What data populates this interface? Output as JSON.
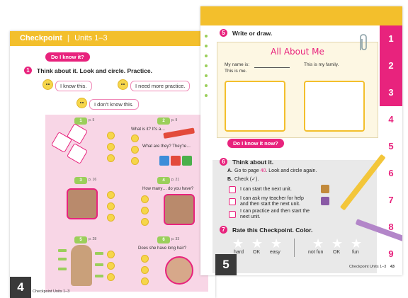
{
  "left_page": {
    "header_title": "Checkpoint",
    "header_sub": "Units 1–3",
    "pill": "Do I know it?",
    "q1_num": "1",
    "q1_text": "Think about it. Look and circle. Practice.",
    "opt_know": "I know this.",
    "opt_more": "I need more practice.",
    "opt_dont": "I don't know this.",
    "cells": [
      {
        "num": "1",
        "ref": "p. 5"
      },
      {
        "num": "2",
        "ref": "p. 9",
        "line1": "What is it? It's a…",
        "line2": "What are they? They're…"
      },
      {
        "num": "3",
        "ref": "p. 16"
      },
      {
        "num": "4",
        "ref": "p. 21",
        "line1": "How many… do you have?"
      },
      {
        "num": "5",
        "ref": "p. 28"
      },
      {
        "num": "6",
        "ref": "p. 33",
        "line1": "Does she have long hair?"
      }
    ],
    "page_number": "4",
    "footer": "Checkpoint Units 1–3"
  },
  "right_page": {
    "q5_num": "5",
    "q5_text": "Write or draw.",
    "note_title": "All About Me",
    "name_label": "My name is:",
    "this_is_me": "This is me.",
    "family_label": "This is my family.",
    "pill": "Do I know it now?",
    "q6_num": "6",
    "q6_text": "Think about it.",
    "a_label": "A.",
    "a_text_pre": "Go to page",
    "a_page": "40",
    "a_text_post": ". Look and circle again.",
    "b_label": "B.",
    "b_text": "Check (✓).",
    "check1": "I can start the next unit.",
    "check2a": "I can ask my teacher for help",
    "check2b": "and then start the next unit.",
    "check3a": "I can practice and then start the",
    "check3b": "next unit.",
    "q7_num": "7",
    "q7_text": "Rate this Checkpoint. Color.",
    "rate_left": [
      "hard",
      "OK",
      "easy"
    ],
    "rate_right": [
      "not fun",
      "OK",
      "fun"
    ],
    "tabs": [
      "1",
      "2",
      "3",
      "4",
      "5",
      "6",
      "7",
      "8",
      "9"
    ],
    "page_number": "5",
    "footer": "Checkpoint Units 1–3",
    "footer_num": "43"
  },
  "colors": {
    "accent": "#e8237d",
    "header": "#f3bf2c",
    "green": "#9bcf5b"
  },
  "icons": [
    "smiley-face-icon",
    "paperclip-icon",
    "star-icon",
    "pencil-icon"
  ]
}
